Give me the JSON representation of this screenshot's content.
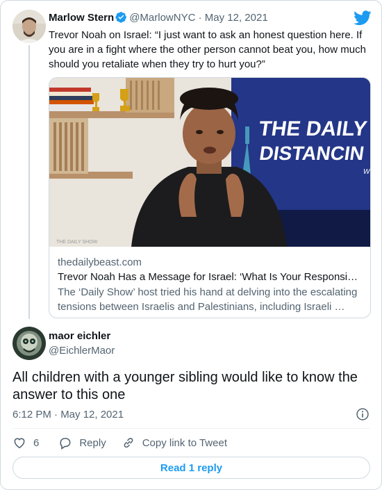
{
  "quoted_tweet": {
    "author_name": "Marlow Stern",
    "handle": "@MarlowNYC",
    "separator": "·",
    "date": "May 12, 2021",
    "text": "Trevor Noah on Israel: “I just want to ask an honest question here. If you are in a fight where the other person cannot beat you, how much should you retaliate when they try to hurt you?”"
  },
  "link_card": {
    "image_watermark": "THE DAILY SHOW",
    "screen_text_line1": "THE DAILY SO",
    "screen_text_line2": "DISTANCIN",
    "screen_text_line3": "WIT",
    "domain": "thedailybeast.com",
    "title": "Trevor Noah Has a Message for Israel: ‘What Is Your Responsibility?’",
    "description": "The ‘Daily Show’ host tried his hand at delving into the escalating tensions between Israelis and Palestinians, including Israeli …"
  },
  "reply_tweet": {
    "author_name": "maor eichler",
    "handle": "@EichlerMaor",
    "text": "All children with a younger sibling would like to know the answer to this one",
    "timestamp": "6:12 PM · May 12, 2021"
  },
  "actions": {
    "like_count": "6",
    "reply_label": "Reply",
    "copy_link_label": "Copy link to Tweet"
  },
  "read_reply_label": "Read 1 reply",
  "icons": {
    "brand": "twitter-bird-icon",
    "verified": "verified-badge-icon",
    "info": "info-icon",
    "like": "heart-icon",
    "reply": "speech-bubble-icon",
    "copy_link": "link-icon"
  },
  "colors": {
    "twitter_blue": "#1d9bf0",
    "text_primary": "#0f1419",
    "text_secondary": "#536471",
    "border": "#cfd9de"
  }
}
